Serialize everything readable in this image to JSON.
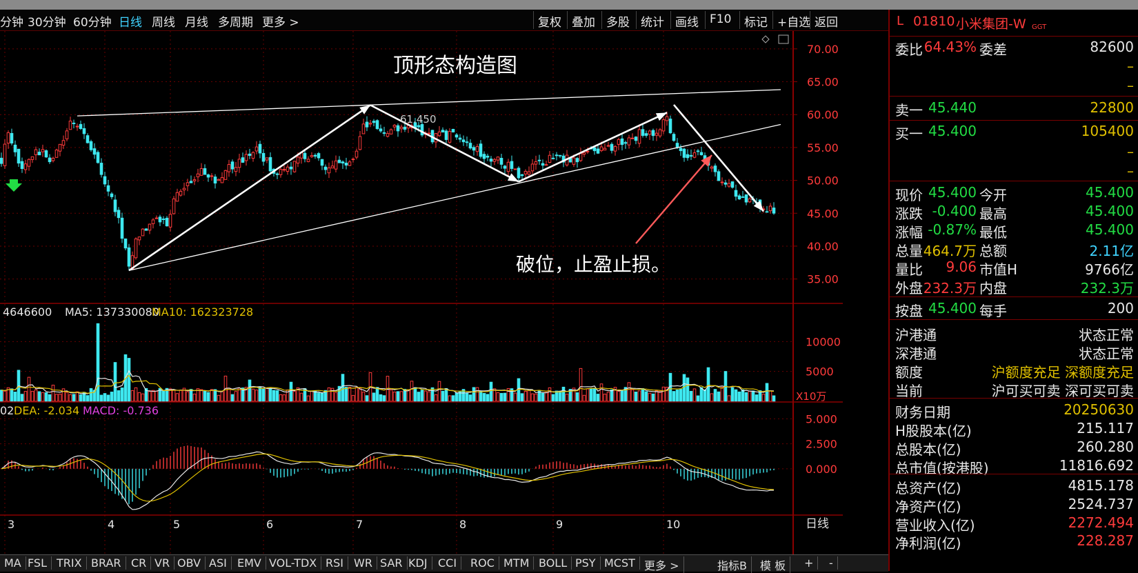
{
  "toolbar": {
    "periods": [
      "分钟",
      "30分钟",
      "60分钟",
      "日线",
      "周线",
      "月线",
      "多周期",
      "更多 >"
    ],
    "active_period": "日线",
    "buttons": [
      "复权",
      "叠加",
      "多股",
      "统计",
      "画线",
      "F10",
      "标记",
      "+自选",
      "返回"
    ]
  },
  "chart_annotations": {
    "title": "顶形态构造图",
    "peak_label": "61.450",
    "note": "破位，止盈止损。",
    "period_label": "日线"
  },
  "volume_header": {
    "vol": "4646600",
    "ma5_label": "MA5: 137330080",
    "ma10_label": "MA10: 162323728",
    "unit": "X10万"
  },
  "macd_header": {
    "dif": "02",
    "dea_label": "DEA: -2.034",
    "macd_label": "MACD: -0.736"
  },
  "bottom_tabs": [
    "MA",
    "FSL",
    "TRIX",
    "BRAR",
    "CR",
    "VR",
    "OBV",
    "ASI",
    "EMV",
    "VOL-TDX",
    "RSI",
    "WR",
    "SAR",
    "KDJ",
    "CCI",
    "ROC",
    "MTM",
    "BOLL",
    "PSY",
    "MCST",
    "更多 >",
    "指标B",
    "模 板",
    "+",
    "-"
  ],
  "quote": {
    "code_prefix": "L",
    "code": "01810",
    "name": "小米集团-W",
    "suffix": "GGT",
    "rows": [
      {
        "l1": "委比",
        "v1": "64.43%",
        "c1": "#ff3b3b",
        "l2": "委差",
        "v2": "82600",
        "c2": "#e8e8e8"
      },
      {
        "l1": "",
        "v1": "",
        "c1": "#e8e8e8",
        "l2": "",
        "v2": "–",
        "c2": "#e0c000"
      },
      {
        "l1": "",
        "v1": "",
        "c1": "#e8e8e8",
        "l2": "",
        "v2": "–",
        "c2": "#e0c000"
      },
      {
        "l1": "卖一",
        "v1": "45.440",
        "c1": "#22dd44",
        "l2": "",
        "v2": "22800",
        "c2": "#e0c000"
      },
      {
        "l1": "买一",
        "v1": "45.400",
        "c1": "#22dd44",
        "l2": "",
        "v2": "105400",
        "c2": "#e0c000"
      },
      {
        "l1": "",
        "v1": "",
        "c1": "#e8e8e8",
        "l2": "",
        "v2": "–",
        "c2": "#e0c000"
      },
      {
        "l1": "",
        "v1": "",
        "c1": "#e8e8e8",
        "l2": "",
        "v2": "–",
        "c2": "#e0c000"
      },
      {
        "l1": "现价",
        "v1": "45.400",
        "c1": "#22dd44",
        "l2": "今开",
        "v2": "45.400",
        "c2": "#22dd44"
      },
      {
        "l1": "涨跌",
        "v1": "-0.400",
        "c1": "#22dd44",
        "l2": "最高",
        "v2": "45.400",
        "c2": "#22dd44"
      },
      {
        "l1": "涨幅",
        "v1": "-0.87%",
        "c1": "#22dd44",
        "l2": "最低",
        "v2": "45.400",
        "c2": "#22dd44"
      },
      {
        "l1": "总量",
        "v1": "464.7万",
        "c1": "#e0c000",
        "l2": "总额",
        "v2": "2.11亿",
        "c2": "#3fd3ff"
      },
      {
        "l1": "量比",
        "v1": "9.06",
        "c1": "#ff3b3b",
        "l2": "市值H",
        "v2": "9766亿",
        "c2": "#e8e8e8"
      },
      {
        "l1": "外盘",
        "v1": "232.3万",
        "c1": "#ff3b3b",
        "l2": "内盘",
        "v2": "232.3万",
        "c2": "#22dd44"
      },
      {
        "l1": "按盘",
        "v1": "45.400",
        "c1": "#22dd44",
        "l2": "每手",
        "v2": "200",
        "c2": "#e8e8e8"
      }
    ],
    "connect": [
      {
        "label": "沪港通",
        "value": "状态正常",
        "color": "#e8e8e8"
      },
      {
        "label": "深港通",
        "value": "状态正常",
        "color": "#e8e8e8"
      },
      {
        "label": "额度",
        "value": "沪额度充足 深额度充足",
        "color": "#e0c000"
      },
      {
        "label": "当前",
        "value": "沪可买可卖 深可买可卖",
        "color": "#e8e8e8"
      }
    ],
    "finance": [
      {
        "label": "财务日期",
        "value": "20250630",
        "color": "#e0c000"
      },
      {
        "label": "H股股本(亿)",
        "value": "215.117",
        "color": "#e8e8e8"
      },
      {
        "label": "总股本(亿)",
        "value": "260.280",
        "color": "#e8e8e8"
      },
      {
        "label": "总市值(按港股)",
        "value": "11816.692",
        "color": "#e8e8e8"
      },
      {
        "label": "总资产(亿)",
        "value": "4815.178",
        "color": "#e8e8e8"
      },
      {
        "label": "净资产(亿)",
        "value": "2524.737",
        "color": "#e8e8e8"
      },
      {
        "label": "营业收入(亿)",
        "value": "2272.494",
        "color": "#ff3b3b"
      },
      {
        "label": "净利润(亿)",
        "value": "228.287",
        "color": "#ff3b3b"
      }
    ]
  },
  "chart_data": {
    "type": "candlestick",
    "price_axis": {
      "ticks": [
        "70.00",
        "65.00",
        "60.00",
        "55.00",
        "50.00",
        "45.00",
        "40.00",
        "35.00"
      ],
      "ylim": [
        31.5,
        72.5
      ]
    },
    "volume_axis": {
      "ticks": [
        "10000",
        "5000"
      ],
      "ylim": [
        0,
        13500
      ]
    },
    "macd_axis": {
      "ticks": [
        "5.000",
        "2.500",
        "0.000"
      ],
      "ylim": [
        -4.5,
        6.2
      ]
    },
    "months": [
      "3",
      "4",
      "5",
      "6",
      "7",
      "8",
      "9",
      "10"
    ],
    "month_start_index": [
      1,
      30,
      49,
      76,
      102,
      132,
      160,
      192
    ],
    "anchors": [
      [
        0,
        53
      ],
      [
        2,
        57
      ],
      [
        6,
        52
      ],
      [
        10,
        55
      ],
      [
        14,
        53
      ],
      [
        20,
        58.5
      ],
      [
        24,
        57
      ],
      [
        30,
        50
      ],
      [
        34,
        44
      ],
      [
        37,
        37.5
      ],
      [
        40,
        42
      ],
      [
        44,
        44
      ],
      [
        48,
        43.5
      ],
      [
        50,
        47.5
      ],
      [
        54,
        49
      ],
      [
        58,
        51.5
      ],
      [
        62,
        50
      ],
      [
        66,
        52
      ],
      [
        70,
        53
      ],
      [
        74,
        55
      ],
      [
        78,
        52
      ],
      [
        82,
        51
      ],
      [
        86,
        53.5
      ],
      [
        90,
        54
      ],
      [
        94,
        52
      ],
      [
        98,
        52.5
      ],
      [
        102,
        53.5
      ],
      [
        105,
        58
      ],
      [
        107,
        59
      ],
      [
        111,
        57.5
      ],
      [
        115,
        58
      ],
      [
        120,
        58
      ],
      [
        125,
        56.5
      ],
      [
        130,
        57
      ],
      [
        134,
        56.5
      ],
      [
        138,
        54.5
      ],
      [
        142,
        53.5
      ],
      [
        146,
        52.5
      ],
      [
        150,
        51
      ],
      [
        154,
        52
      ],
      [
        158,
        53
      ],
      [
        162,
        53.5
      ],
      [
        166,
        53
      ],
      [
        170,
        55
      ],
      [
        174,
        54.5
      ],
      [
        178,
        55.5
      ],
      [
        182,
        56
      ],
      [
        186,
        57.5
      ],
      [
        190,
        57
      ],
      [
        193,
        59.5
      ],
      [
        195,
        56
      ],
      [
        197,
        54
      ],
      [
        201,
        54
      ],
      [
        205,
        53
      ],
      [
        208,
        50.5
      ],
      [
        212,
        48.5
      ],
      [
        216,
        47
      ],
      [
        220,
        46
      ],
      [
        223,
        45.4
      ]
    ],
    "drawn_lines": [
      {
        "from": [
          37,
          36.3
        ],
        "to": [
          107,
          61.45
        ],
        "arrow": true
      },
      {
        "from": [
          107,
          61.45
        ],
        "to": [
          150,
          49.8
        ],
        "arrow": true
      },
      {
        "from": [
          150,
          49.8
        ],
        "to": [
          193,
          60.3
        ],
        "arrow": true
      },
      {
        "from": [
          195,
          61.5
        ],
        "to": [
          221,
          45.3
        ],
        "arrow": true
      },
      {
        "from": [
          22,
          59.8
        ],
        "to": [
          226,
          63.8
        ],
        "arrow": false
      },
      {
        "from": [
          37,
          36.3
        ],
        "to": [
          226,
          58.5
        ],
        "arrow": false
      }
    ]
  }
}
